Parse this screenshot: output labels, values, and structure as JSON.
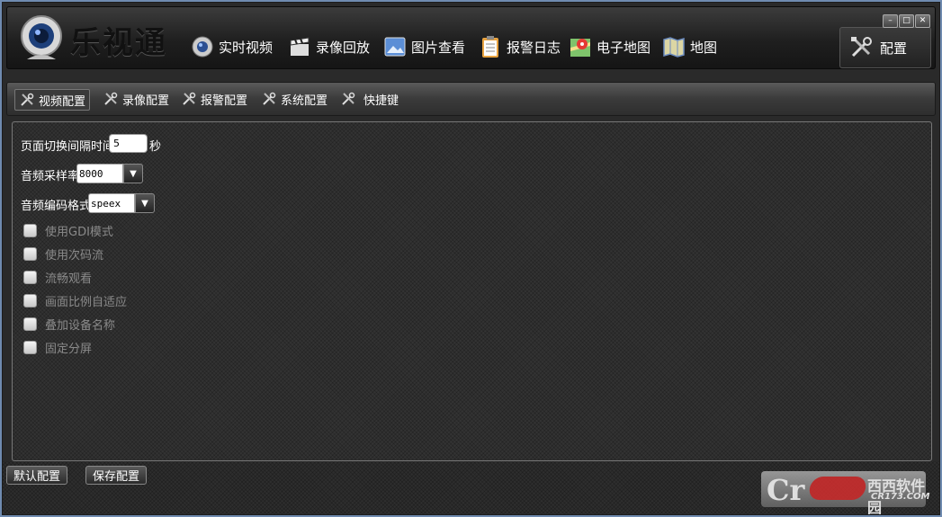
{
  "header": {
    "app_title": "乐视通",
    "nav": [
      {
        "label": "实时视频",
        "icon": "camera-icon"
      },
      {
        "label": "录像回放",
        "icon": "clapperboard-icon"
      },
      {
        "label": "图片查看",
        "icon": "picture-icon"
      },
      {
        "label": "报警日志",
        "icon": "clipboard-icon"
      },
      {
        "label": "电子地图",
        "icon": "map-pin-icon"
      },
      {
        "label": "地图",
        "icon": "folded-map-icon"
      }
    ],
    "config_label": "配置"
  },
  "tabs": [
    {
      "label": "视频配置",
      "active": true
    },
    {
      "label": "录像配置",
      "active": false
    },
    {
      "label": "报警配置",
      "active": false
    },
    {
      "label": "系统配置",
      "active": false
    },
    {
      "label": "快捷键",
      "active": false
    }
  ],
  "form": {
    "interval_label": "页面切换间隔时间",
    "interval_value": "5",
    "interval_unit": "秒",
    "sample_rate_label": "音频采样率",
    "sample_rate_value": "8000",
    "codec_label": "音频编码格式",
    "codec_value": "speex",
    "checkboxes": [
      {
        "label": "使用GDI模式",
        "checked": false
      },
      {
        "label": "使用次码流",
        "checked": false
      },
      {
        "label": "流畅观看",
        "checked": false
      },
      {
        "label": "画面比例自适应",
        "checked": false
      },
      {
        "label": "叠加设备名称",
        "checked": false
      },
      {
        "label": "固定分屏",
        "checked": false
      }
    ]
  },
  "footer": {
    "default_label": "默认配置",
    "save_label": "保存配置"
  },
  "watermark": {
    "logo_c": "Cr",
    "brand": "西西软件园",
    "site": "CR173.COM"
  }
}
